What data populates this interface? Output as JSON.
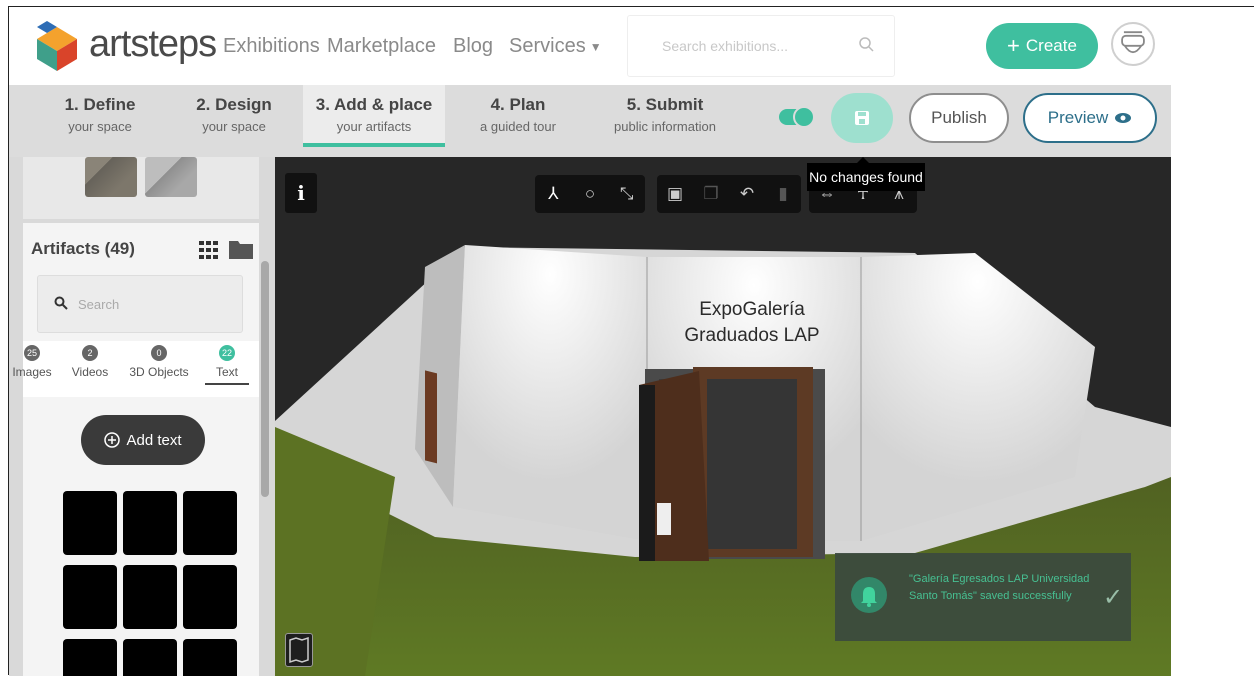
{
  "brand": {
    "name": "artsteps"
  },
  "nav": {
    "links": [
      "Exhibitions",
      "Marketplace",
      "Blog",
      "Services"
    ],
    "search_placeholder": "Search exhibitions...",
    "create_label": "Create"
  },
  "steps": [
    {
      "title": "1. Define",
      "subtitle": "your space"
    },
    {
      "title": "2. Design",
      "subtitle": "your space"
    },
    {
      "title": "3. Add & place",
      "subtitle": "your artifacts"
    },
    {
      "title": "4. Plan",
      "subtitle": "a guided tour"
    },
    {
      "title": "5. Submit",
      "subtitle": "public information"
    }
  ],
  "actions": {
    "publish_label": "Publish",
    "preview_label": "Preview",
    "save_tooltip": "No changes found"
  },
  "artifacts": {
    "title": "Artifacts (49)",
    "search_placeholder": "Search",
    "filters": [
      {
        "count": "25",
        "label": "Images"
      },
      {
        "count": "2",
        "label": "Videos"
      },
      {
        "count": "0",
        "label": "3D Objects"
      },
      {
        "count": "22",
        "label": "Text"
      }
    ],
    "add_text_label": "Add text"
  },
  "viewport": {
    "info_label": "i",
    "wall_text": [
      "ExpoGalería",
      "Graduados LAP"
    ],
    "toast_message": "\"Galería Egresados LAP Universidad Santo Tomás\" saved successfully"
  },
  "colors": {
    "accent": "#3fbf9f",
    "preview": "#2d6f8a",
    "toast_text": "#46c79c"
  }
}
